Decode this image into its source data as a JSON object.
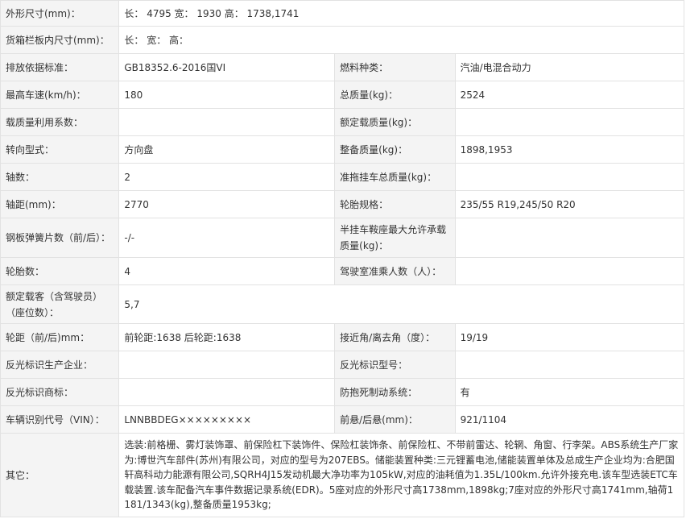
{
  "rows": [
    {
      "l1": "外形尺寸(mm)：",
      "v1": "长： 4795 宽： 1930 高： 1738,1741"
    },
    {
      "l1": "货箱栏板内尺寸(mm)：",
      "v1": "长：  宽：  高："
    },
    {
      "l1": "排放依据标准：",
      "v1": "GB18352.6-2016国VI",
      "l2": "燃料种类：",
      "v2": "汽油/电混合动力"
    },
    {
      "l1": "最高车速(km/h)：",
      "v1": "180",
      "l2": "总质量(kg)：",
      "v2": "2524"
    },
    {
      "l1": "载质量利用系数：",
      "v1": "",
      "l2": "额定载质量(kg)：",
      "v2": ""
    },
    {
      "l1": "转向型式：",
      "v1": "方向盘",
      "l2": "整备质量(kg)：",
      "v2": "1898,1953"
    },
    {
      "l1": "轴数：",
      "v1": "2",
      "l2": "准拖挂车总质量(kg)：",
      "v2": ""
    },
    {
      "l1": "轴距(mm)：",
      "v1": "2770",
      "l2": "轮胎规格：",
      "v2": "235/55 R19,245/50 R20"
    },
    {
      "l1": "钢板弹簧片数（前/后）：",
      "v1": "-/-",
      "l2": "半挂车鞍座最大允许承载质量(kg)：",
      "v2": ""
    },
    {
      "l1": "轮胎数：",
      "v1": "4",
      "l2": "驾驶室准乘人数（人）：",
      "v2": ""
    },
    {
      "l1": "额定载客（含驾驶员）（座位数）：",
      "v1": "5,7"
    },
    {
      "l1": "轮距（前/后)mm：",
      "v1": "前轮距:1638 后轮距:1638",
      "l2": "接近角/离去角（度）：",
      "v2": "19/19"
    },
    {
      "l1": "反光标识生产企业：",
      "v1": "",
      "l2": "反光标识型号：",
      "v2": ""
    },
    {
      "l1": "反光标识商标：",
      "v1": "",
      "l2": "防抱死制动系统：",
      "v2": "有"
    },
    {
      "l1": "车辆识别代号（VIN）：",
      "v1": "LNNBBDEG×××××××××",
      "l2": "前悬/后悬(mm)：",
      "v2": "921/1104"
    },
    {
      "l1": "其它：",
      "v1": "选装:前格栅、雾灯装饰罩、前保险杠下装饰件、保险杠装饰条、前保险杠、不带前雷达、轮辋、角窗、行李架。ABS系统生产厂家为:博世汽车部件(苏州)有限公司，对应的型号为207EBS。储能装置种类:三元锂蓄电池,储能装置单体及总成生产企业均为:合肥国轩高科动力能源有限公司,SQRH4J15发动机最大净功率为105kW,对应的油耗值为1.35L/100km.允许外接充电.该车型选装ETC车载装置.该车配备汽车事件数据记录系统(EDR)。5座对应的外形尺寸高1738mm,1898kg;7座对应的外形尺寸高1741mm,轴荷1181/1343(kg),整备质量1953kg;"
    }
  ]
}
